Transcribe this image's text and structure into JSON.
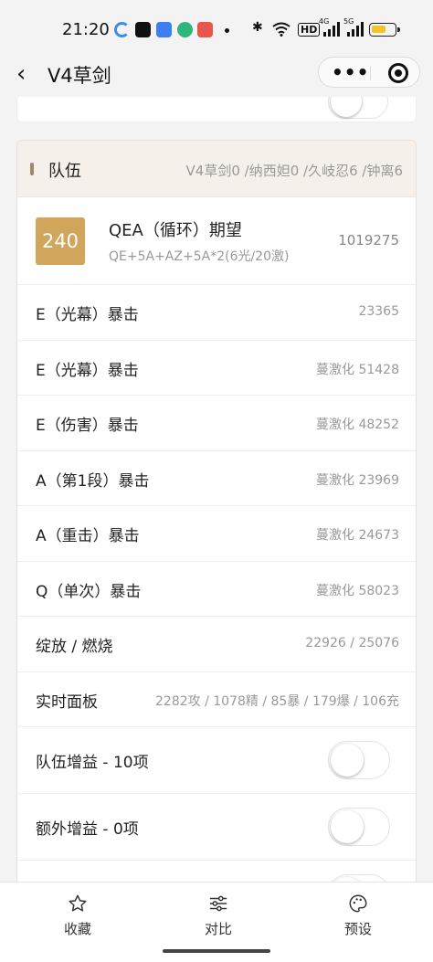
{
  "status_bar": {
    "time": "21:20",
    "icons": [
      "bluetooth-icon",
      "wifi-icon",
      "hd-icon",
      "signal-4g-icon",
      "signal-5g-icon",
      "battery-icon"
    ],
    "network_labels": {
      "hd": "HD",
      "g4": "4G",
      "g5": "5G"
    }
  },
  "nav": {
    "title": "V4草剑",
    "back_icon": "‹"
  },
  "team_card": {
    "title": "队伍",
    "team_summary": "V4草剑0 /纳西妲0 /久岐忍6 /钟离6",
    "main": {
      "badge": "240",
      "title": "QEA（循环）期望",
      "subtitle": "QE+5A+AZ+5A*2(6光/20激)",
      "value": "1019275"
    },
    "rows": [
      {
        "label": "E（光幕）暴击",
        "value": "23365"
      },
      {
        "label": "E（光幕）暴击",
        "value": "蔓激化 51428"
      },
      {
        "label": "E（伤害）暴击",
        "value": "蔓激化 48252"
      },
      {
        "label": "A（第1段）暴击",
        "value": "蔓激化 23969"
      },
      {
        "label": "A（重击）暴击",
        "value": "蔓激化 24673"
      },
      {
        "label": "Q（单次）暴击",
        "value": "蔓激化 58023"
      },
      {
        "label": "绽放 / 燃烧",
        "value": "22926 / 25076"
      },
      {
        "label": "实时面板",
        "value": "2282攻 / 1078精 / 85暴 / 179爆 / 106充"
      }
    ],
    "toggles": [
      {
        "label": "队伍增益 - 10项",
        "on": false
      },
      {
        "label": "额外增益 - 0项",
        "on": false
      }
    ]
  },
  "tabbar": {
    "tabs": [
      {
        "label": "收藏",
        "icon": "star-icon"
      },
      {
        "label": "对比",
        "icon": "sliders-icon"
      },
      {
        "label": "预设",
        "icon": "palette-icon"
      }
    ]
  },
  "colors": {
    "badge": "#d2a55c",
    "header_bg": "#f5f1ea",
    "accent_bar": "#a08870",
    "battery": "#f4c430"
  }
}
